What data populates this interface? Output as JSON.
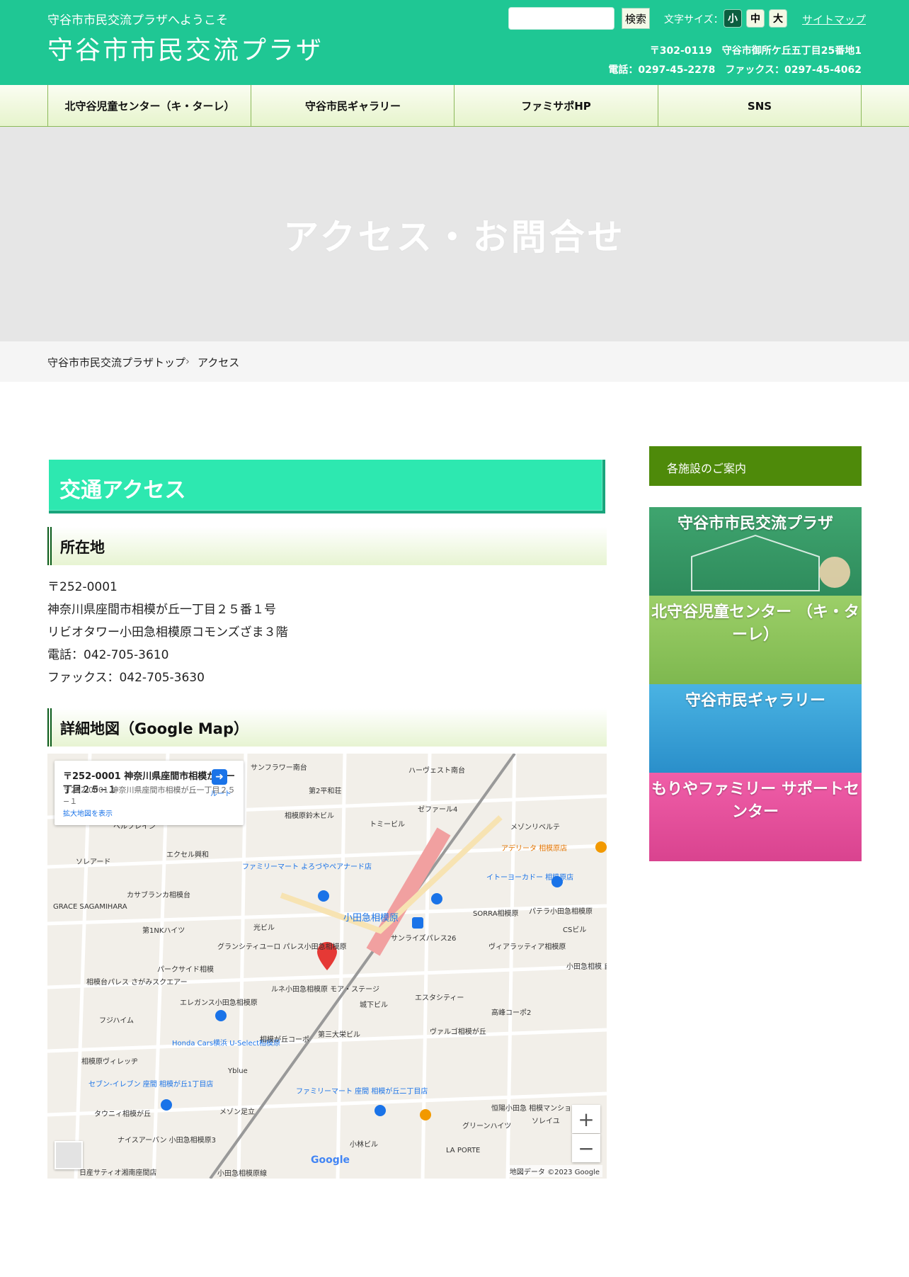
{
  "header": {
    "welcome": "守谷市市民交流プラザへようこそ",
    "title": "守谷市市民交流プラザ",
    "search_placeholder": "",
    "search_button": "検索",
    "font_size_label": "文字サイズ：",
    "font_small": "小",
    "font_medium": "中",
    "font_large": "大",
    "sitemap": "サイトマップ",
    "address": "〒302-0119　守谷市御所ケ丘五丁目25番地1",
    "phone": "電話：0297-45-2278　ファックス：0297-45-4062"
  },
  "nav": {
    "items": [
      "北守谷児童センター（キ・ターレ）",
      "守谷市民ギャラリー",
      "ファミサポHP",
      "SNS"
    ]
  },
  "hero": {
    "title": "アクセス・お問合せ"
  },
  "breadcrumb": {
    "home": "守谷市市民交流プラザトップ",
    "separator": "›",
    "current": "アクセス"
  },
  "main": {
    "heading": "交通アクセス",
    "location_heading": "所在地",
    "location_lines": [
      "〒252-0001",
      "神奈川県座間市相模が丘一丁目２５番１号",
      "リビオタワー小田急相模原コモンズざま３階",
      "電話：042-705-3610",
      "ファックス：042-705-3630"
    ],
    "map_heading": "詳細地図（Google Map）"
  },
  "map": {
    "card_title": "〒252-0001 神奈川県座間市相模が丘一丁目２５−１",
    "card_sub": "〒252-0001 神奈川県座間市相模が丘一丁目２５−１",
    "card_link": "拡大地図を表示",
    "directions_label": "ルート",
    "station_label": "小田急相模原",
    "labels": [
      "サンフラワー南台",
      "ハーヴェスト南台",
      "第2平和荘",
      "ゼファール4",
      "相模原鈴木ビル",
      "トミービル",
      "メゾンリベルテ",
      "ベルフレイン",
      "エクセル興和",
      "ファミリーマート よろづやペアナード店",
      "アデリータ 相模原店",
      "イトーヨーカドー 相模原店",
      "ソレアード",
      "カサブランカ相模台",
      "GRACE SAGAMIHARA",
      "SORRA相模原",
      "パテラ小田急相模原",
      "第1NKハイツ",
      "光ビル",
      "CSビル",
      "グランシティユーロ パレス小田急相模原",
      "サンライズパレス26",
      "ヴィアラッティア相模原",
      "パークサイド相模",
      "相模台パレス さがみスクエアー",
      "ルネ小田急相模原 モア・ステージ",
      "城下ビル",
      "エスタシティー",
      "エレガンス小田急相模原",
      "高峰コーポ2",
      "フジハイム",
      "Honda Cars横浜 U-Select相模原",
      "第三大栄ビル",
      "相模が丘コーポ",
      "ヴァルゴ相模が丘",
      "相模原ヴィレッヂ",
      "セブン-イレブン 座間 相模が丘1丁目店",
      "ファミリーマート 座間 相模が丘二丁目店",
      "Yblue",
      "タウニィ相模が丘",
      "メゾン足立",
      "恒陽小田急 相模マンション",
      "グリーンハイツ",
      "ソレイユ",
      "ナイスアーバン 小田急相模原3",
      "小林ビル",
      "LA PORTE",
      "日産サティオ湘南座間店",
      "小田急相模原線",
      "小田急相模 自転車駐車"
    ],
    "copyright": "地図データ ©2023 Google",
    "google": "Google",
    "zoom_in": "+",
    "zoom_out": "−"
  },
  "sidebar": {
    "heading": "各施設のご案内",
    "banners": [
      "守谷市市民交流プラザ",
      "北守谷児童センター （キ・ターレ）",
      "守谷市民ギャラリー",
      "もりやファミリー サポートセンター"
    ]
  },
  "colors": {
    "header": "#1fc794",
    "accent": "#2de8b0",
    "sidebar_head": "#4e8a0a"
  }
}
